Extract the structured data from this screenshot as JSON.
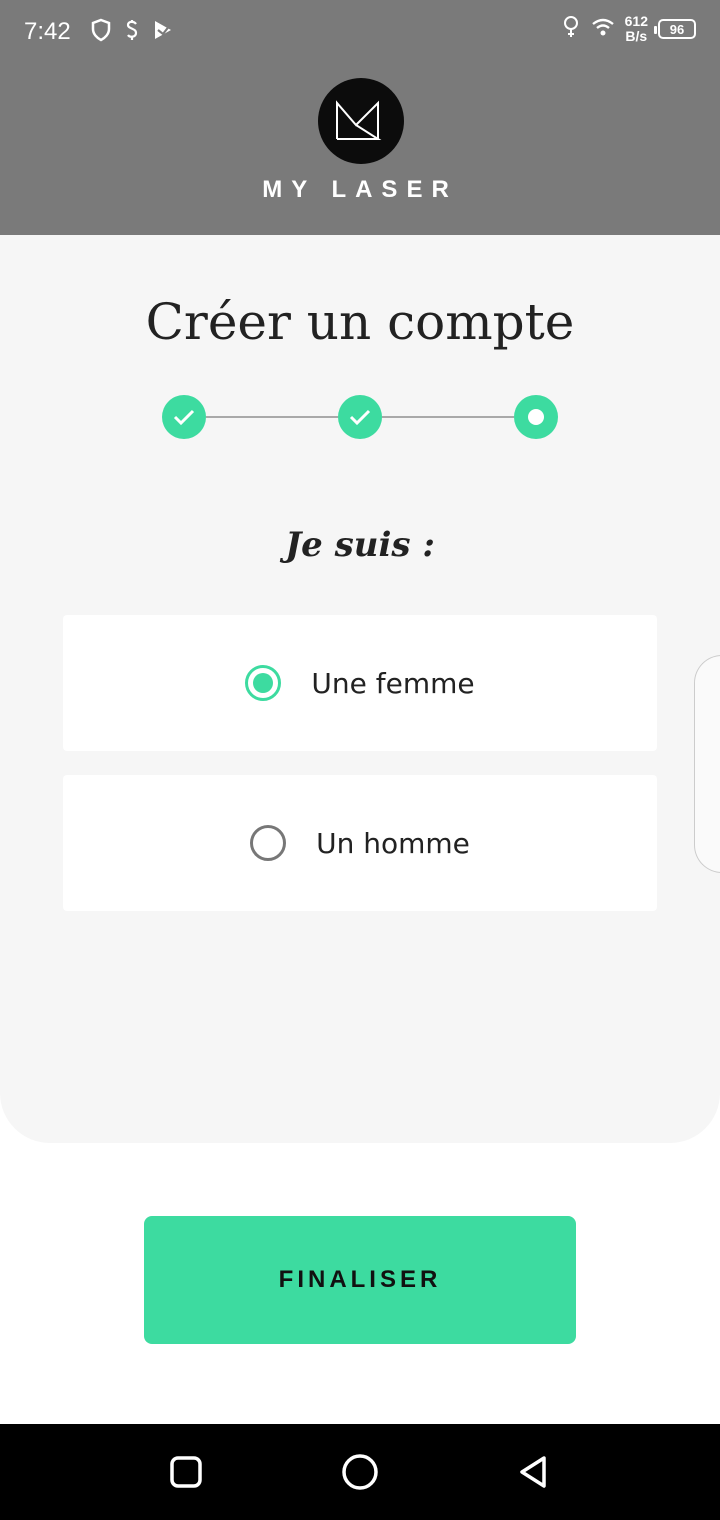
{
  "status_bar": {
    "time": "7:42",
    "net_speed_value": "612",
    "net_speed_unit": "B/s",
    "battery": "96",
    "icons": [
      "shield-icon",
      "dollar-icon",
      "play-store-icon",
      "bulb-icon",
      "wifi-icon"
    ]
  },
  "header": {
    "logo_icon": "my-laser-logo",
    "brand": "MY LASER"
  },
  "main": {
    "title": "Créer un compte",
    "stepper": {
      "steps": [
        {
          "state": "completed",
          "icon": "check-icon"
        },
        {
          "state": "completed",
          "icon": "check-icon"
        },
        {
          "state": "current",
          "icon": "dot-icon"
        }
      ]
    },
    "subtitle": "Je suis :",
    "options": [
      {
        "label": "Une femme",
        "selected": true
      },
      {
        "label": "Un homme",
        "selected": false
      }
    ]
  },
  "cta": {
    "label": "FINALISER"
  },
  "colors": {
    "accent": "#3ddba0",
    "header_bg": "#7a7a7a",
    "card_bg": "#f6f6f6",
    "text": "#222222"
  },
  "nav_bar": {
    "buttons": [
      "recents-icon",
      "home-icon",
      "back-icon"
    ]
  }
}
